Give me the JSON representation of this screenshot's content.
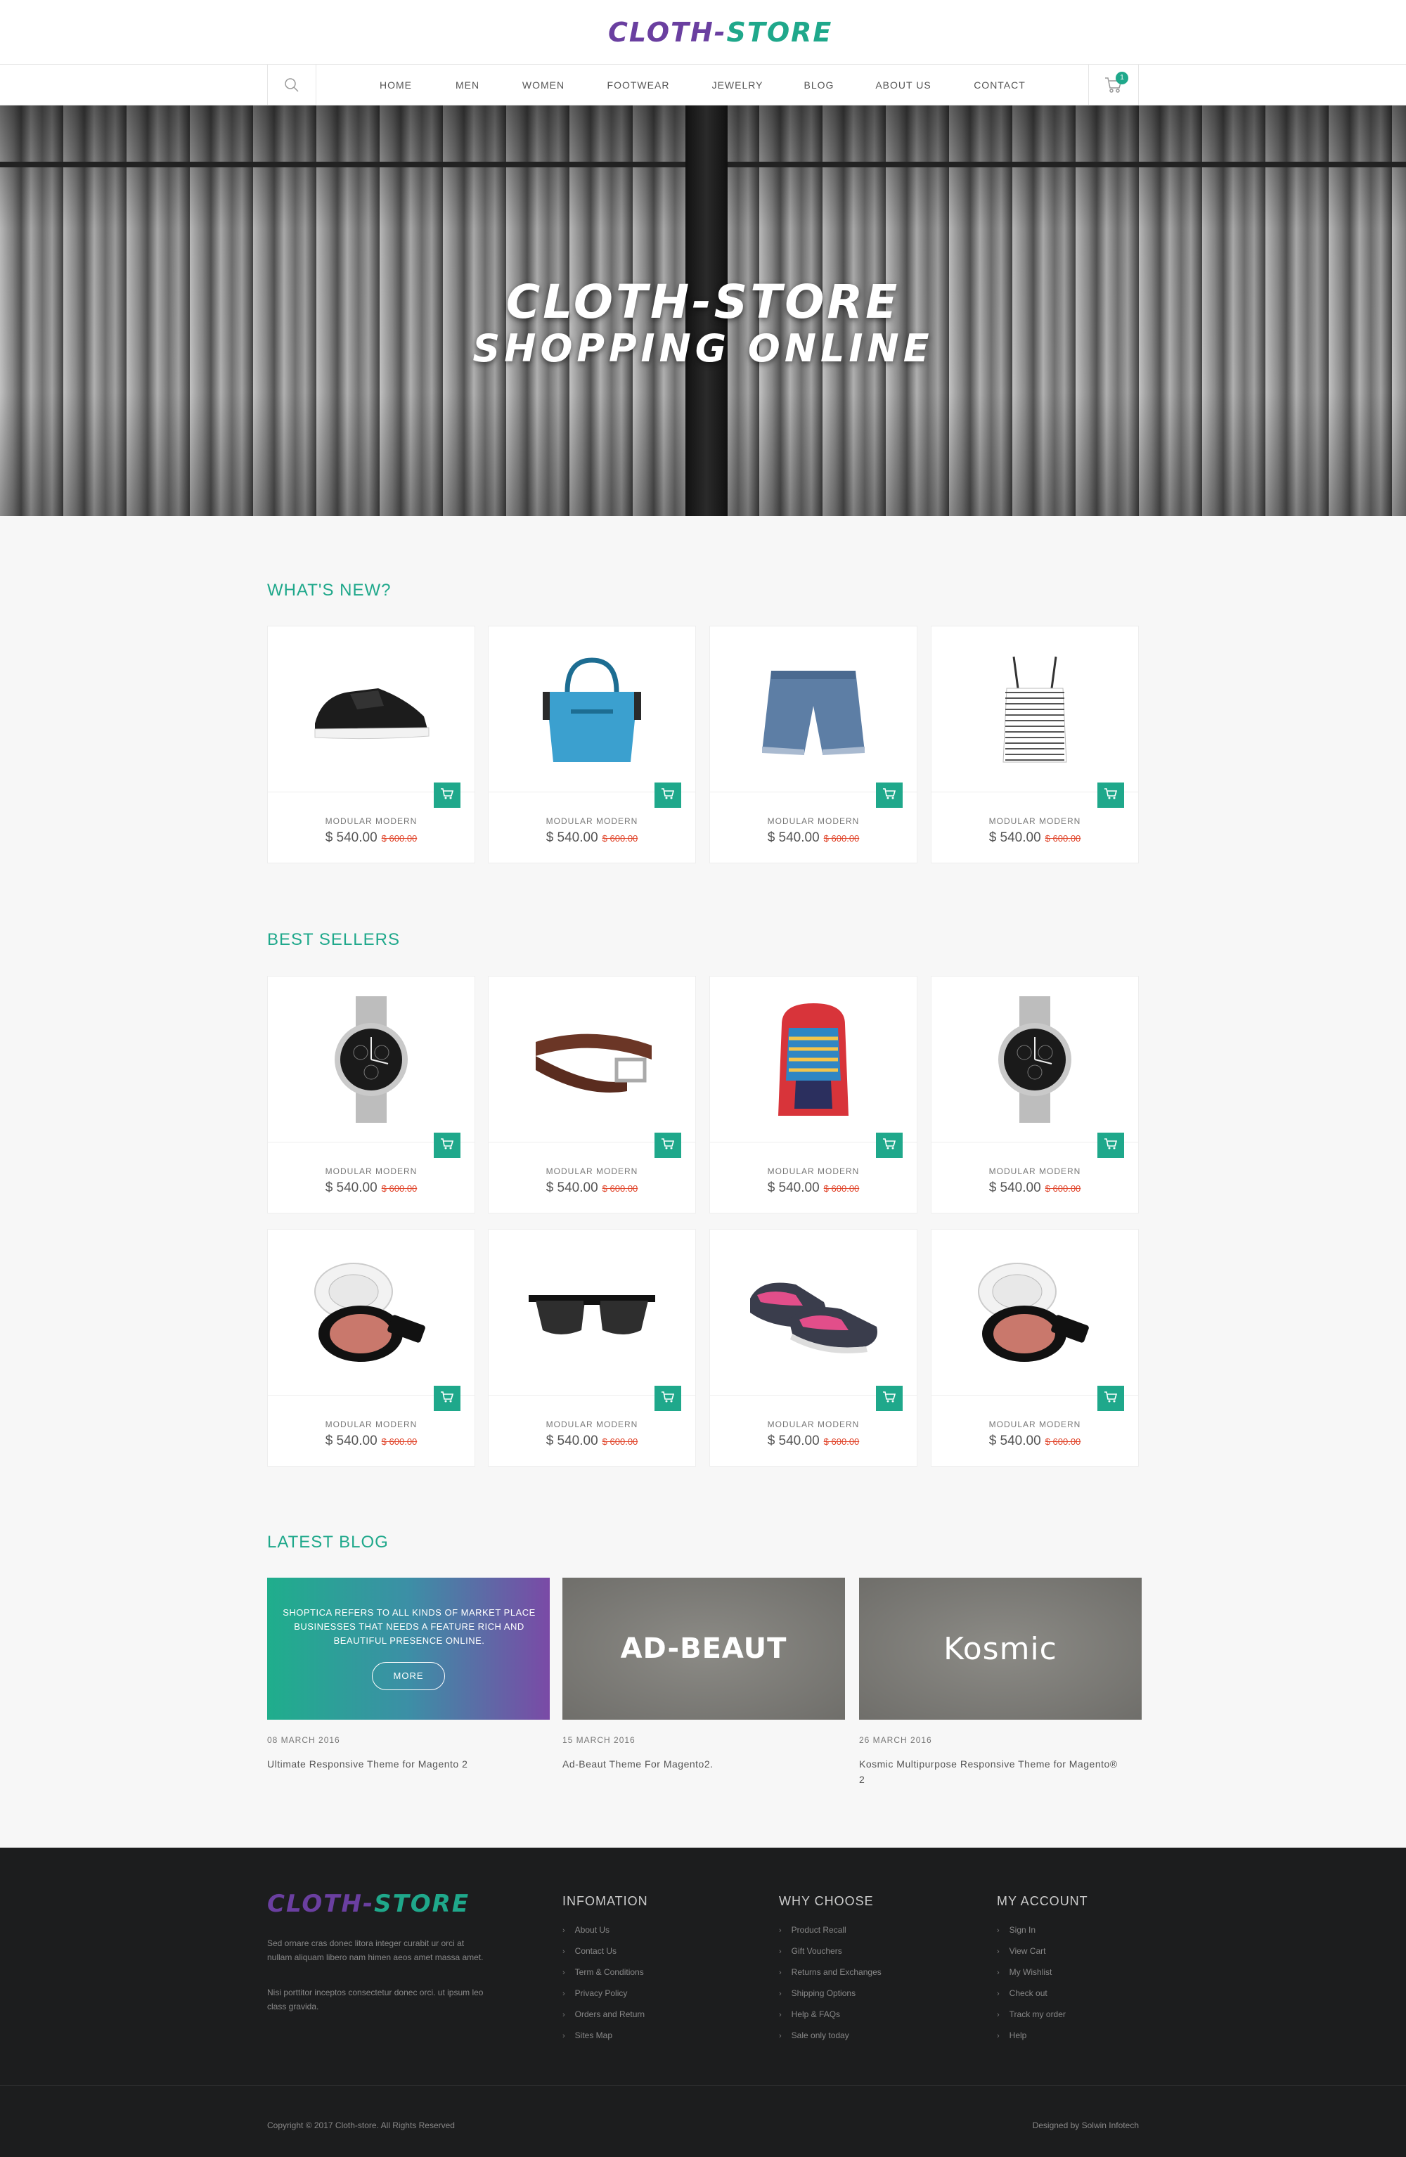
{
  "header": {
    "logo_part1": "CLOTH-",
    "logo_part2": "STORE",
    "nav": [
      "HOME",
      "MEN",
      "WOMEN",
      "FOOTWEAR",
      "JEWELRY",
      "BLOG",
      "ABOUT US",
      "CONTACT"
    ],
    "cart_count": "1"
  },
  "hero": {
    "line1": "CLOTH-STORE",
    "line2": "SHOPPING ONLINE"
  },
  "whats_new": {
    "title": "WHAT'S NEW?",
    "products": [
      {
        "name": "MODULAR MODERN",
        "price": "$ 540.00",
        "old_price": "$ 600.00",
        "image": "sneaker"
      },
      {
        "name": "MODULAR MODERN",
        "price": "$ 540.00",
        "old_price": "$ 600.00",
        "image": "handbag"
      },
      {
        "name": "MODULAR MODERN",
        "price": "$ 540.00",
        "old_price": "$ 600.00",
        "image": "denim-shorts"
      },
      {
        "name": "MODULAR MODERN",
        "price": "$ 540.00",
        "old_price": "$ 600.00",
        "image": "crop-top"
      }
    ]
  },
  "best_sellers": {
    "title": "BEST SELLERS",
    "products": [
      {
        "name": "MODULAR MODERN",
        "price": "$ 540.00",
        "old_price": "$ 600.00",
        "image": "watch"
      },
      {
        "name": "MODULAR MODERN",
        "price": "$ 540.00",
        "old_price": "$ 600.00",
        "image": "belt"
      },
      {
        "name": "MODULAR MODERN",
        "price": "$ 540.00",
        "old_price": "$ 600.00",
        "image": "backpack"
      },
      {
        "name": "MODULAR MODERN",
        "price": "$ 540.00",
        "old_price": "$ 600.00",
        "image": "watch"
      },
      {
        "name": "MODULAR MODERN",
        "price": "$ 540.00",
        "old_price": "$ 600.00",
        "image": "compact"
      },
      {
        "name": "MODULAR MODERN",
        "price": "$ 540.00",
        "old_price": "$ 600.00",
        "image": "sunglasses"
      },
      {
        "name": "MODULAR MODERN",
        "price": "$ 540.00",
        "old_price": "$ 600.00",
        "image": "flats"
      },
      {
        "name": "MODULAR MODERN",
        "price": "$ 540.00",
        "old_price": "$ 600.00",
        "image": "compact"
      }
    ]
  },
  "blog": {
    "title": "LATEST BLOG",
    "posts": [
      {
        "date": "08 MARCH 2016",
        "title": "Ultimate Responsive Theme for Magento 2",
        "promo_text": "SHOPTICA REFERS TO ALL KINDS OF MARKET PLACE BUSINESSES THAT NEEDS A FEATURE RICH AND BEAUTIFUL PRESENCE ONLINE.",
        "button": "MORE"
      },
      {
        "date": "15 MARCH 2016",
        "title": "Ad-Beaut Theme For Magento2.",
        "brand": "AD-BEAUT"
      },
      {
        "date": "26 MARCH 2016",
        "title": "Kosmic Multipurpose Responsive Theme for Magento® 2",
        "brand": "Kosmic"
      }
    ]
  },
  "footer": {
    "logo_part1": "CLOTH-",
    "logo_part2": "STORE",
    "text1": "Sed ornare cras donec litora integer curabit ur orci at nullam aliquam libero nam himen aeos amet massa amet.",
    "text2": "Nisi porttitor inceptos consectetur donec orci. ut ipsum leo class gravida.",
    "columns": [
      {
        "title": "INFOMATION",
        "items": [
          "About Us",
          "Contact Us",
          "Term & Conditions",
          "Privacy Policy",
          "Orders and Return",
          "Sites Map"
        ]
      },
      {
        "title": "WHY CHOOSE",
        "items": [
          "Product Recall",
          "Gift Vouchers",
          "Returns and Exchanges",
          "Shipping Options",
          "Help & FAQs",
          "Sale only today"
        ]
      },
      {
        "title": "MY ACCOUNT",
        "items": [
          "Sign In",
          "View Cart",
          "My Wishlist",
          "Check out",
          "Track my order",
          "Help"
        ]
      }
    ],
    "copyright": "Copyright © 2017 Cloth-store. All Rights Reserved",
    "designed_by": "Designed by Solwin Infotech"
  },
  "colors": {
    "accent": "#1fa88b",
    "logo_purple": "#6a3fa0",
    "old_price": "#e0442a",
    "footer_bg": "#1c1d1e"
  }
}
